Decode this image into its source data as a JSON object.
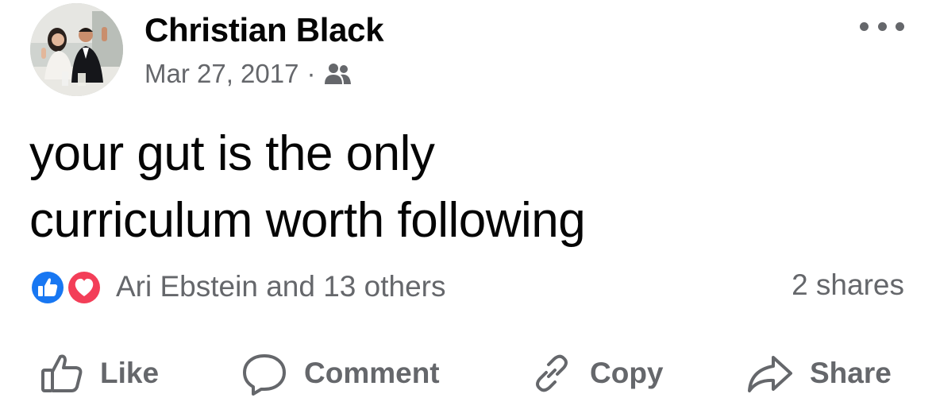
{
  "post": {
    "author": "Christian Black",
    "date": "Mar 27, 2017",
    "separator": "·",
    "audience_icon": "friends-icon",
    "text_lines": [
      "your gut is the only",
      "curriculum worth following"
    ],
    "reactions": {
      "icons": [
        "like-reaction-icon",
        "love-reaction-icon"
      ],
      "summary": "Ari Ebstein and 13 others"
    },
    "shares": "2 shares"
  },
  "actions": {
    "like": "Like",
    "comment": "Comment",
    "copy": "Copy",
    "share": "Share"
  },
  "colors": {
    "text": "#050505",
    "secondary": "#65676b",
    "like_blue": "#1877f2",
    "love_red": "#f33e58"
  }
}
